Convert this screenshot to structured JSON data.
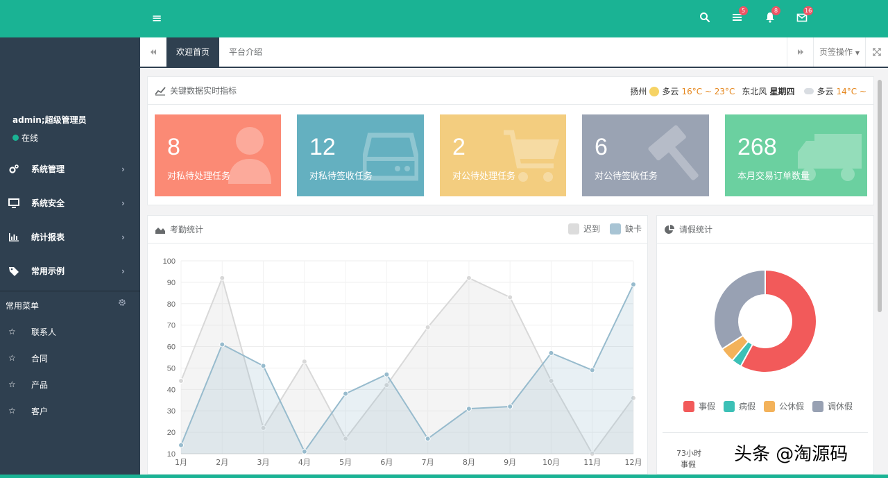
{
  "topbar": {
    "badges": {
      "tasks": "5",
      "notifications": "8",
      "messages": "16"
    }
  },
  "sidebar": {
    "user_name": "admin;超级管理员",
    "user_status": "在线",
    "menu": [
      {
        "label": "系统管理",
        "icon": "cogs-icon"
      },
      {
        "label": "系统安全",
        "icon": "monitor-icon"
      },
      {
        "label": "统计报表",
        "icon": "bar-chart-icon"
      },
      {
        "label": "常用示例",
        "icon": "tag-icon"
      }
    ],
    "section_title": "常用菜单",
    "favorites": [
      "联系人",
      "合同",
      "产品",
      "客户"
    ]
  },
  "tabs": {
    "items": [
      "欢迎首页",
      "平台介绍"
    ],
    "active": 0,
    "ops_label": "页签操作"
  },
  "kpi_panel": {
    "title": "关键数据实时指标",
    "weather": {
      "city": "扬州",
      "today_desc": "多云",
      "today_temp": "16°C ~ 23°C",
      "wind": "东北风",
      "weekday": "星期四",
      "next_desc": "多云",
      "next_temp": "14°C ~"
    },
    "cards": [
      {
        "value": "8",
        "label": "对私待处理任务",
        "color": "#fb8a75",
        "icon": "user-icon"
      },
      {
        "value": "12",
        "label": "对私待签收任务",
        "color": "#64b0c0",
        "icon": "hard-drive-icon"
      },
      {
        "value": "2",
        "label": "对公待处理任务",
        "color": "#f3cd7f",
        "icon": "cart-icon"
      },
      {
        "value": "6",
        "label": "对公待签收任务",
        "color": "#9aa3b3",
        "icon": "gavel-icon"
      },
      {
        "value": "268",
        "label": "本月交易订单数量",
        "color": "#6bd0a0",
        "icon": "truck-icon"
      }
    ]
  },
  "attendance_panel": {
    "title": "考勤统计",
    "legend": [
      {
        "label": "迟到",
        "color": "#dcdcdc"
      },
      {
        "label": "缺卡",
        "color": "#a8c4d4"
      }
    ]
  },
  "leave_panel": {
    "title": "请假统计",
    "legend": [
      {
        "label": "事假",
        "color": "#f25a5a"
      },
      {
        "label": "病假",
        "color": "#3cc0b6"
      },
      {
        "label": "公休假",
        "color": "#f3b25a"
      },
      {
        "label": "调休假",
        "color": "#98a1b3"
      }
    ],
    "footer_hours": "73小时",
    "footer_label": "事假"
  },
  "chart_data": [
    {
      "type": "area",
      "x": [
        "1月",
        "2月",
        "3月",
        "4月",
        "5月",
        "6月",
        "7月",
        "8月",
        "9月",
        "10月",
        "11月",
        "12月"
      ],
      "ylim": [
        10,
        100
      ],
      "yticks": [
        10,
        20,
        30,
        40,
        50,
        60,
        70,
        80,
        90,
        100
      ],
      "series": [
        {
          "name": "迟到",
          "values": [
            44,
            92,
            22,
            53,
            17,
            42,
            69,
            92,
            83,
            44,
            10,
            36
          ]
        },
        {
          "name": "缺卡",
          "values": [
            14,
            61,
            51,
            11,
            38,
            47,
            17,
            31,
            32,
            57,
            49,
            89
          ]
        }
      ],
      "grid": true,
      "legend": "top-right"
    },
    {
      "type": "pie",
      "donut": true,
      "labels": [
        "事假",
        "病假",
        "公休假",
        "调休假"
      ],
      "values": [
        73,
        4,
        6,
        43
      ]
    }
  ],
  "watermark": "头条 @淘源码"
}
